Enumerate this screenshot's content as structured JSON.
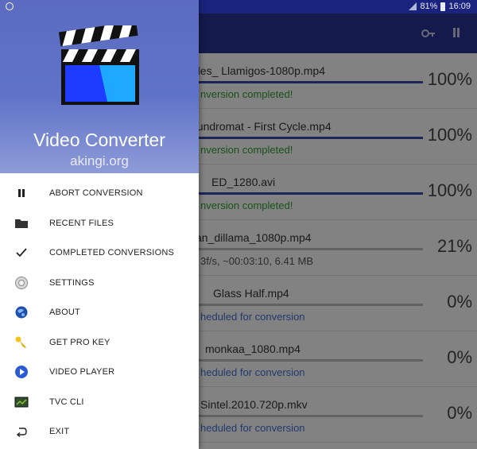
{
  "status_bar": {
    "battery": "81%",
    "time": "16:09"
  },
  "drawer": {
    "title": "Video Converter",
    "subtitle": "akingi.org",
    "items": [
      {
        "label": "ABORT CONVERSION",
        "icon": "pause-icon"
      },
      {
        "label": "RECENT FILES",
        "icon": "folder-icon"
      },
      {
        "label": "COMPLETED CONVERSIONS",
        "icon": "checkmark-icon"
      },
      {
        "label": "SETTINGS",
        "icon": "settings-icon"
      },
      {
        "label": "ABOUT",
        "icon": "info-globe-icon"
      },
      {
        "label": "GET PRO KEY",
        "icon": "key-icon"
      },
      {
        "label": "VIDEO PLAYER",
        "icon": "play-icon"
      },
      {
        "label": "TVC CLI",
        "icon": "terminal-icon"
      },
      {
        "label": "EXIT",
        "icon": "exit-icon"
      }
    ]
  },
  "conversions": [
    {
      "file": "des_ Llamigos-1080p.mp4",
      "percent": "100%",
      "progress": 1.0,
      "status": "nversion completed!",
      "state": "done"
    },
    {
      "file": "aundromat - First Cycle.mp4",
      "percent": "100%",
      "progress": 1.0,
      "status": "nversion completed!",
      "state": "done"
    },
    {
      "file": "ED_1280.avi",
      "percent": "100%",
      "progress": 1.0,
      "status": "nversion completed!",
      "state": "done"
    },
    {
      "file": "an_dillama_1080p.mp4",
      "percent": "21%",
      "progress": 0.21,
      "status": "3f/s, ~00:03:10, 6.41 MB",
      "state": "progress"
    },
    {
      "file": "Glass Half.mp4",
      "percent": "0%",
      "progress": 0,
      "status": "heduled for conversion",
      "state": "scheduled"
    },
    {
      "file": "monkaa_1080.mp4",
      "percent": "0%",
      "progress": 0,
      "status": "heduled for conversion",
      "state": "scheduled"
    },
    {
      "file": "Sintel.2010.720p.mkv",
      "percent": "0%",
      "progress": 0,
      "status": "heduled for conversion",
      "state": "scheduled"
    }
  ],
  "colors": {
    "toolbar": "#283593",
    "status_bar": "#1a237e",
    "done": "#2e9e2e",
    "scheduled": "#3f6fd1",
    "progress_bar": "#3949ab"
  }
}
